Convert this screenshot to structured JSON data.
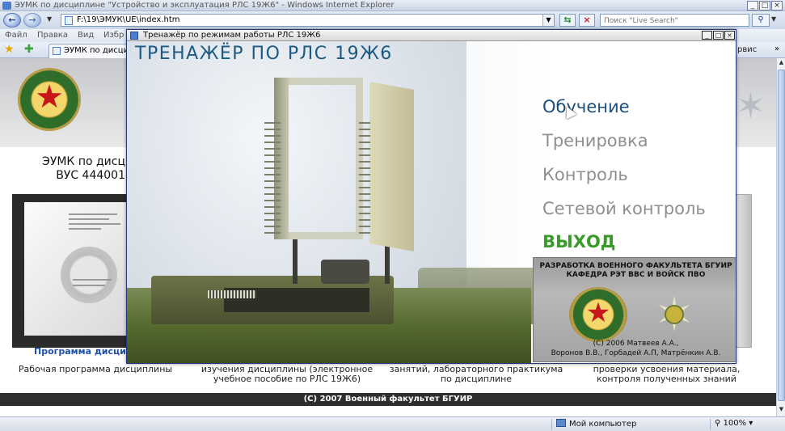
{
  "browser": {
    "window_title": "ЭУМК по дисциплине \"Устройство и эксплуатация РЛС 19Ж6\" - Windows Internet Explorer",
    "address": "F:\\19\\ЭМУК\\UE\\index.htm",
    "search_placeholder": "Поиск \"Live Search\"",
    "menu": [
      "Файл",
      "Правка",
      "Вид",
      "Избр"
    ],
    "tab_title": "ЭУМК по дисциплине",
    "fav_right_label": "рвис",
    "status_zone": "Мой компьютер",
    "zoom": "100%"
  },
  "page": {
    "heading_line1": "ЭУМК по дисц",
    "heading_line2": "ВУС 444001",
    "program_link": "Программа дисци",
    "captions": [
      {
        "line1": "Рабочая программа дисциплины",
        "line2": ""
      },
      {
        "line1": "изучения дисциплины (электронное",
        "line2": "учебное пособие по РЛС 19Ж6)"
      },
      {
        "line1": "занятий, лабораторного практикума",
        "line2": "по дисциплине"
      },
      {
        "line1": "проверки усвоения материала,",
        "line2": "контроля полученных знаний"
      }
    ],
    "footer": "(С) 2007 Военный факультет БГУИР"
  },
  "trainer": {
    "window_title": "Тренажёр по режимам работы РЛС 19Ж6",
    "title": "ТРЕНАЖЁР ПО РЛС 19Ж6",
    "menu": {
      "learn": "Обучение",
      "train": "Тренировка",
      "control": "Контроль",
      "net_control": "Сетевой контроль",
      "exit": "ВЫХОД"
    },
    "credits": {
      "line1": "РАЗРАБОТКА ВОЕННОГО ФАКУЛЬТЕТА БГУИР",
      "line2": "КАФЕДРА РЭТ ВВС И ВОЙСК ПВО",
      "copyright1": "(С) 2006 Матвеев А.А.,",
      "copyright2": "Воронов В.В., Горбадей А.П, Матрёнкин А.В."
    }
  },
  "colors": {
    "menu_active": "#1c4f7e",
    "menu_inactive": "#8f8f8f",
    "menu_exit": "#3a9a2a",
    "trainer_title": "#1c5a82",
    "footer_bg": "#2e2e2e"
  },
  "icons": {
    "back": "back-arrow-icon",
    "forward": "forward-arrow-icon",
    "refresh": "refresh-icon",
    "stop": "stop-icon",
    "search": "search-icon",
    "favorites": "favorites-star-icon",
    "add_favorite": "add-favorite-icon"
  }
}
